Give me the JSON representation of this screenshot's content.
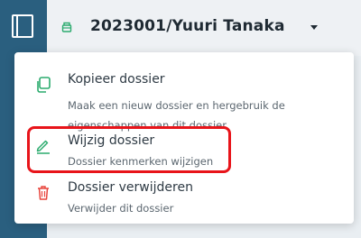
{
  "colors": {
    "sidebar": "#2a5f7f",
    "accent_green": "#2bab6e",
    "delete_red": "#e8453c",
    "highlight_red": "#e8141a"
  },
  "header": {
    "case_title": "2023001/Yuuri Tanaka",
    "case_icon": "case-file-icon",
    "caret_icon": "chevron-down-icon"
  },
  "menu": {
    "items": [
      {
        "title": "Kopieer dossier",
        "description": "Maak een nieuw dossier en hergebruik de eigenschappen van dit dossier",
        "icon": "copy-icon"
      },
      {
        "title": "Wijzig dossier",
        "description": "Dossier kenmerken wijzigen",
        "icon": "pencil-icon",
        "highlighted": true
      },
      {
        "title": "Dossier verwijderen",
        "description": "Verwijder dit dossier",
        "icon": "trash-icon"
      }
    ]
  }
}
